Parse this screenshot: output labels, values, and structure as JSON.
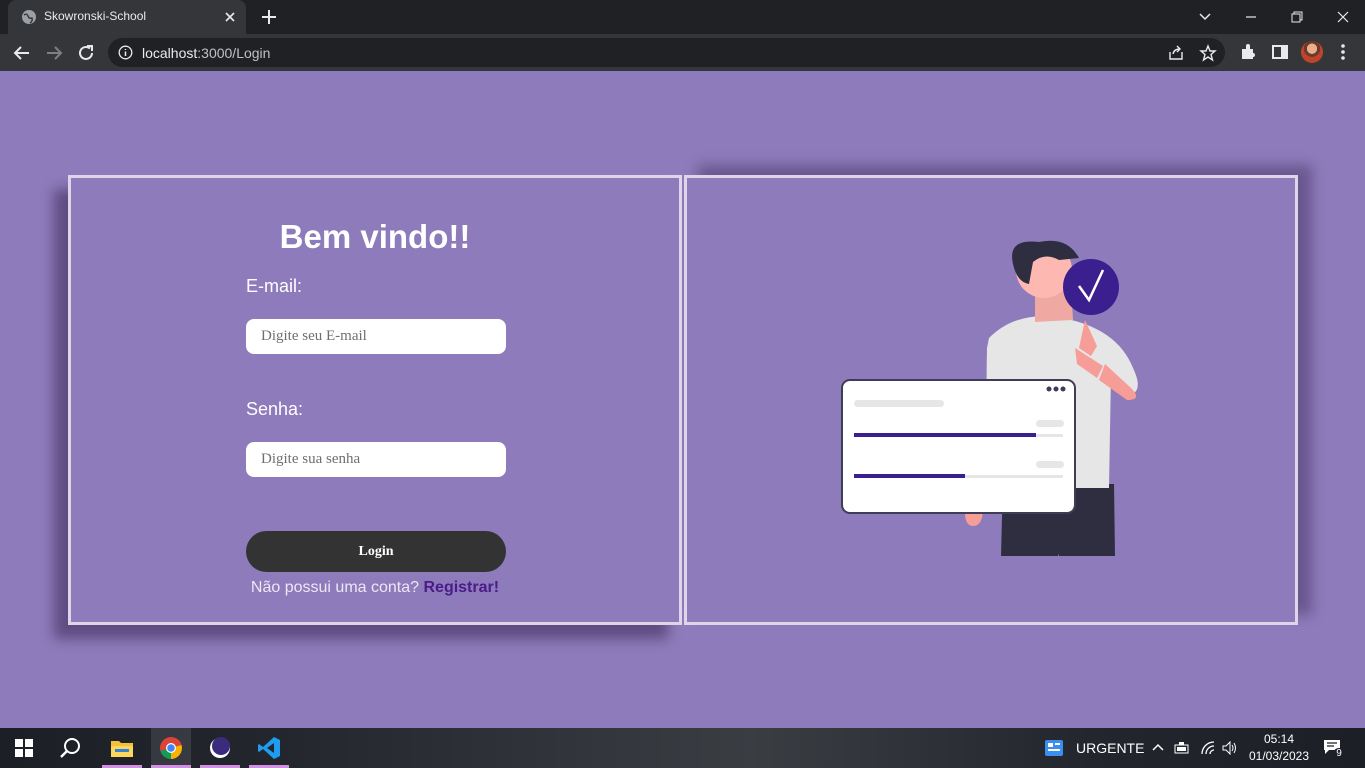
{
  "browser": {
    "tab_title": "Skowronski-School",
    "url_host": "localhost",
    "url_rest": ":3000/Login"
  },
  "login": {
    "heading": "Bem vindo!!",
    "email_label": "E-mail:",
    "email_placeholder": "Digite seu E-mail",
    "password_label": "Senha:",
    "password_placeholder": "Digite sua senha",
    "login_button": "Login",
    "no_account_text": "Não possui uma conta?",
    "register_link": "Registrar!"
  },
  "illustration": {
    "progress_bars": [
      0.87,
      0.53
    ]
  },
  "taskbar": {
    "weather_text": "URGENTE",
    "time": "05:14",
    "date": "01/03/2023",
    "notification_count": "9"
  },
  "colors": {
    "page_background": "#8e7bbb",
    "accent_purple": "#3b1f8e",
    "register_link": "#4a1c8a",
    "login_button": "#333333"
  }
}
